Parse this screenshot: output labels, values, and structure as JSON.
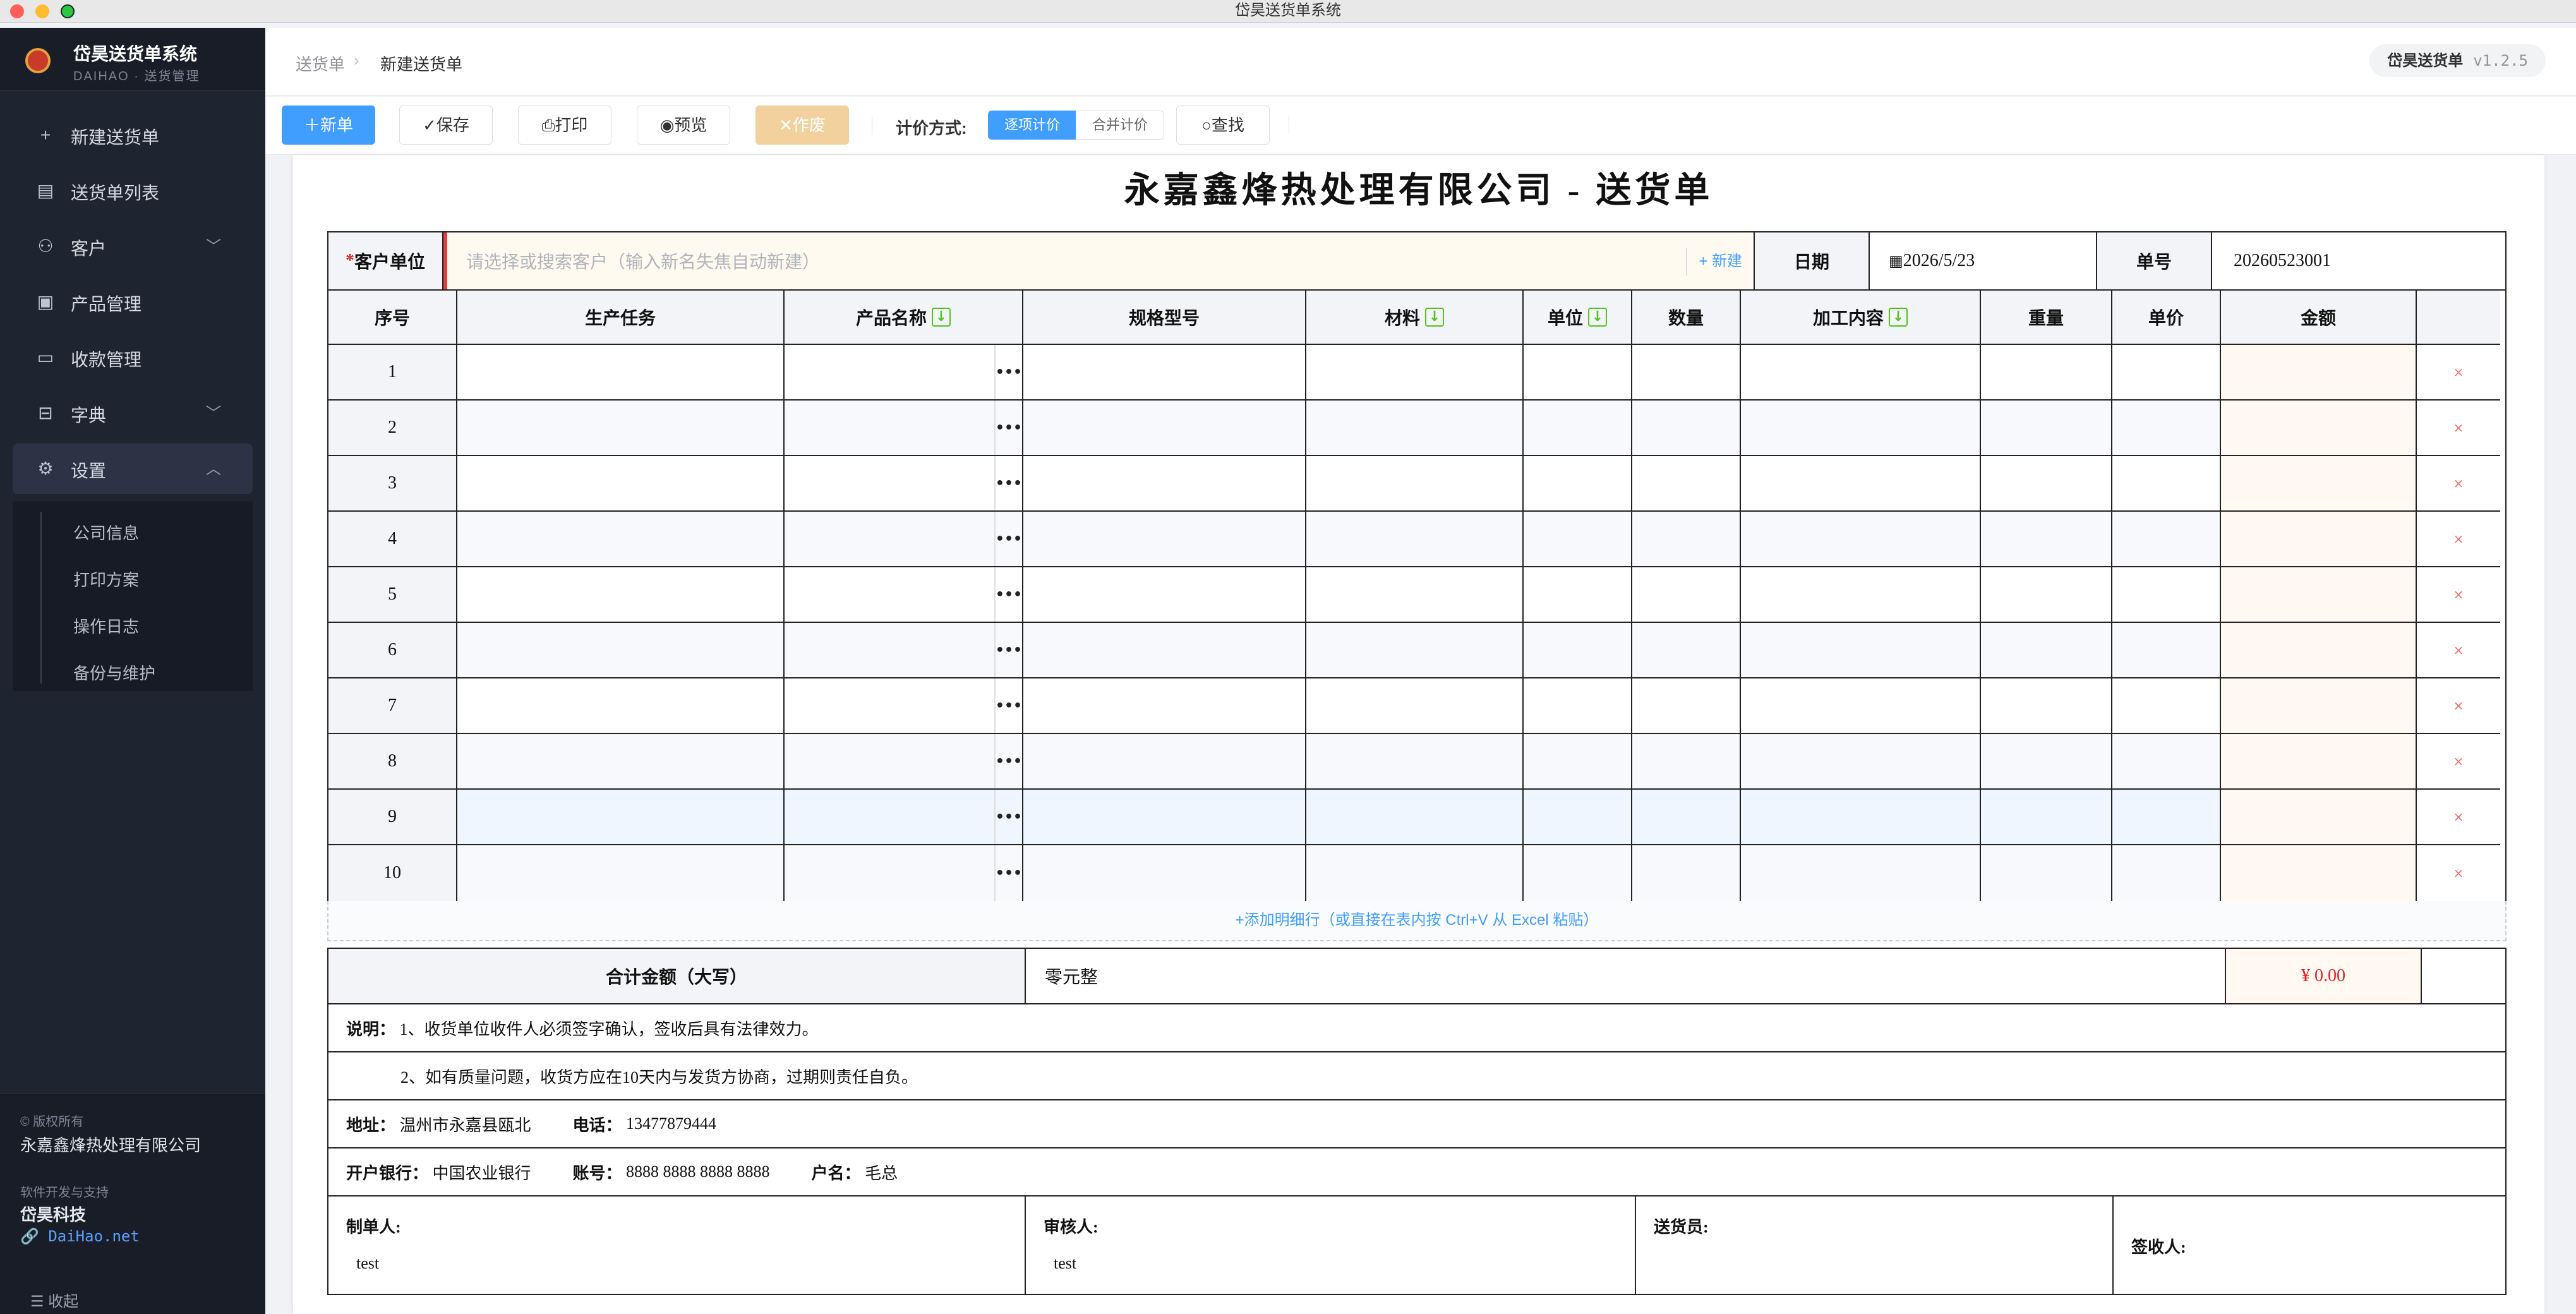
{
  "window": {
    "title": "岱昊送货单系统"
  },
  "sidebar": {
    "brand_name": "岱昊送货单系统",
    "brand_sub": "DAIHAO · 送货管理",
    "items": [
      {
        "label": "新建送货单",
        "icon": "plus-icon"
      },
      {
        "label": "送货单列表",
        "icon": "document-icon"
      },
      {
        "label": "客户",
        "icon": "user-icon",
        "chevron": "down"
      },
      {
        "label": "产品管理",
        "icon": "box-icon"
      },
      {
        "label": "收款管理",
        "icon": "folder-icon"
      },
      {
        "label": "字典",
        "icon": "archive-icon",
        "chevron": "down"
      },
      {
        "label": "设置",
        "icon": "gear-icon",
        "chevron": "up"
      }
    ],
    "sub_items": [
      "公司信息",
      "打印方案",
      "操作日志",
      "备份与维护"
    ],
    "copyright_label": "© 版权所有",
    "company": "永嘉鑫烽热处理有限公司",
    "dev_label": "软件开发与支持",
    "dev_name": "岱昊科技",
    "dev_link": "🔗 DaiHao.net",
    "collapse": "☰  收起"
  },
  "header": {
    "breadcrumb_parent": "送货单",
    "breadcrumb_current": "新建送货单",
    "app_badge": "岱昊送货单",
    "version": "v1.2.5"
  },
  "toolbar": {
    "new": "＋新单",
    "save": "✓保存",
    "print": "⎙打印",
    "preview": "◉预览",
    "void": "✕作废",
    "pricing_label": "计价方式:",
    "pricing_options": [
      "逐项计价",
      "合并计价"
    ],
    "find": "○查找"
  },
  "document": {
    "title": "永嘉鑫烽热处理有限公司 - 送货单",
    "customer_label": "客户单位",
    "required_mark": "*",
    "customer_placeholder": "请选择或搜索客户（输入新名失焦自动新建）",
    "new_customer": "+ 新建",
    "date_label": "日期",
    "date_value": "2026/5/23",
    "number_label": "单号",
    "number_value": "20260523001",
    "columns": [
      "序号",
      "生产任务",
      "产品名称",
      "规格型号",
      "材料",
      "单位",
      "数量",
      "加工内容",
      "重量",
      "单价",
      "金额"
    ],
    "rows": [
      "1",
      "2",
      "3",
      "4",
      "5",
      "6",
      "7",
      "8",
      "9",
      "10"
    ],
    "row_delete": "×",
    "add_row": "+添加明细行（或直接在表内按 Ctrl+V 从 Excel 粘贴）",
    "total_label": "合计金额（大写）",
    "total_words": "零元整",
    "total_amount": "¥ 0.00",
    "note_label": "说明：",
    "note_1": "1、收货单位收件人必须签字确认，签收后具有法律效力。",
    "note_2": "2、如有质量问题，收货方应在10天内与发货方协商，过期则责任自负。",
    "address_label": "地址：",
    "address": "温州市永嘉县瓯北",
    "phone_label": "电话：",
    "phone": "13477879444",
    "bank_label": "开户银行：",
    "bank": "中国农业银行",
    "account_label": "账号：",
    "account": "8888 8888 8888 8888",
    "holder_label": "户名：",
    "holder": "毛总",
    "maker_label": "制单人:",
    "maker": "test",
    "reviewer_label": "审核人:",
    "reviewer": "test",
    "courier_label": "送货员:",
    "receiver_label": "签收人:"
  }
}
